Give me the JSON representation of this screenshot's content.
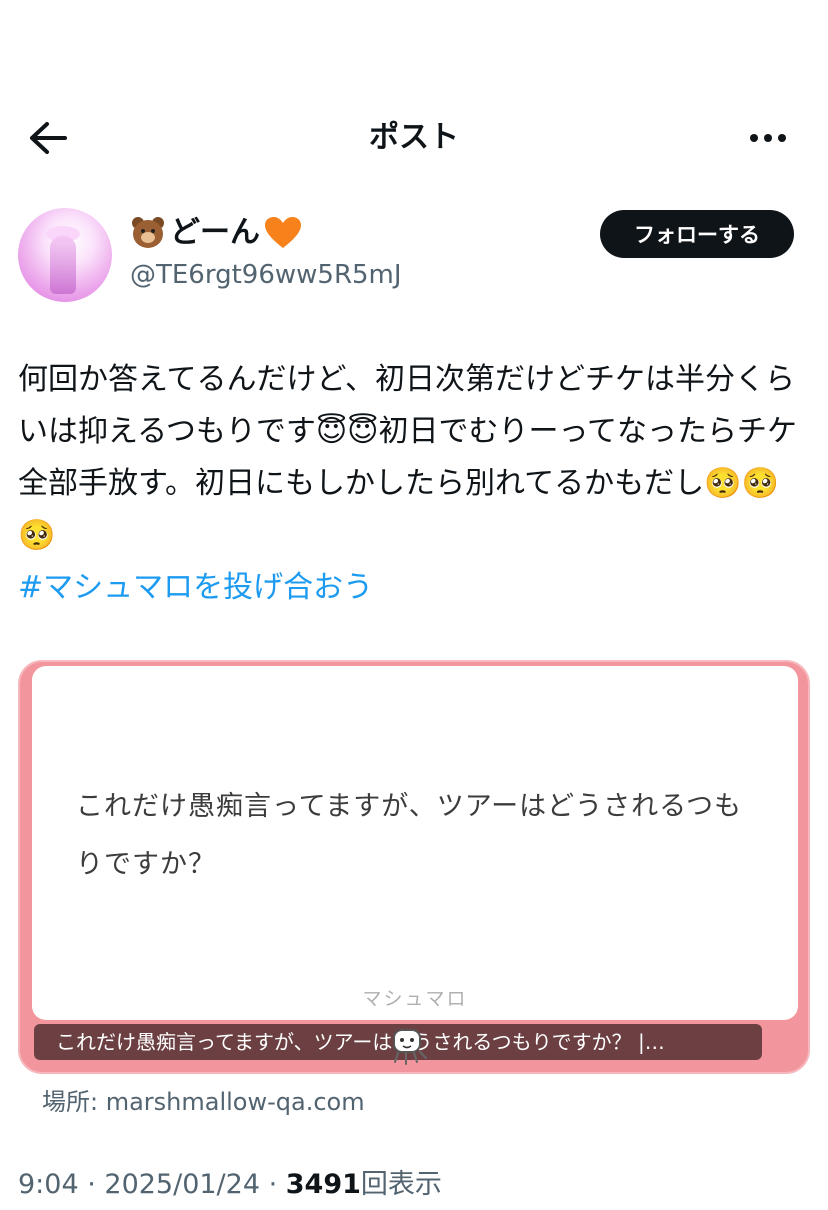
{
  "header": {
    "title": "ポスト",
    "back_icon": "arrow-left-icon",
    "more_icon": "more-horizontal-icon"
  },
  "author": {
    "display_name": "どーん",
    "name_emojis": [
      "bear-face-emoji",
      "orange-heart-emoji"
    ],
    "handle": "@TE6rgt96ww5R5mJ",
    "follow_label": "フォローする"
  },
  "post": {
    "text": "何回か答えてるんだけど、初日次第だけどチケは半分くらいは抑えるつもりです😇😇初日でむりーってなったらチケ全部手放す。初日にもしかしたら別れてるかもだし🥺🥺🥺",
    "hashtag": "#マシュマロを投げ合おう"
  },
  "card": {
    "question": "これだけ愚痴言ってますが、ツアーはどうされるつもりですか？",
    "brand": "マシュマロ",
    "caption": "これだけ愚痴言ってますが、ツアーはどうされるつもりですか？ |…",
    "source_label": "場所: marshmallow-qa.com",
    "background_color": "#f2959c"
  },
  "meta": {
    "time": "9:04",
    "separator": " · ",
    "date": "2025/01/24",
    "views_count": "3491",
    "views_label": "回表示"
  }
}
